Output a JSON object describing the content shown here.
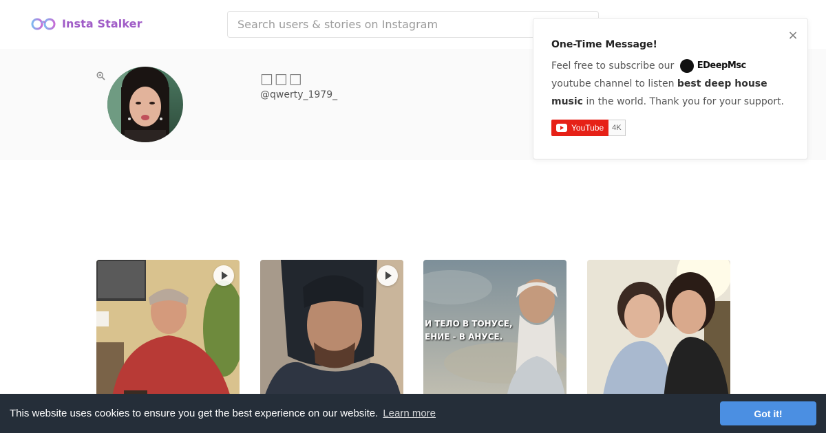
{
  "header": {
    "logo_text": "Insta Stalker",
    "logo_icon": "glasses-icon",
    "search_placeholder": "Search users & stories on Instagram"
  },
  "profile": {
    "name": "□□□",
    "handle": "@qwerty_1979_",
    "zoom_icon": "magnifier-plus-icon"
  },
  "popup": {
    "title": "One-Time Message!",
    "text_1": "Feel free to subscribe our",
    "brand": "EDeepMsc",
    "text_2": "youtube channel to listen",
    "bold_text": "best deep house music",
    "text_3": "in the world. Thank you for your support.",
    "close_glyph": "×",
    "youtube_label": "YouTube",
    "youtube_count": "4K"
  },
  "posts": [
    {
      "type": "video",
      "overlay_text": ""
    },
    {
      "type": "video",
      "overlay_text": ""
    },
    {
      "type": "image",
      "overlay_line_1": "И ТЕЛО В ТОНУСЕ,",
      "overlay_line_2": "ЕНИЕ - В АНУСЕ."
    },
    {
      "type": "image",
      "overlay_text": ""
    }
  ],
  "cookie": {
    "message": "This website uses cookies to ensure you get the best experience on our website.",
    "learn_more": "Learn more",
    "button": "Got it!"
  },
  "colors": {
    "brand_purple": "#a05cc7",
    "cookie_bg": "#252e39",
    "cookie_button": "#4b8fe2",
    "youtube_red": "#e62117"
  }
}
